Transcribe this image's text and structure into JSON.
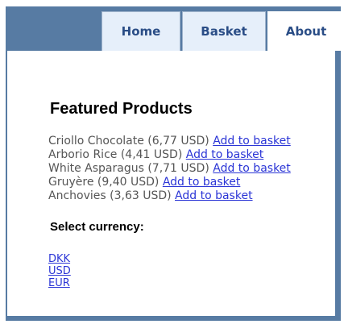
{
  "nav": {
    "tabs": [
      {
        "label": "Home"
      },
      {
        "label": "Basket"
      },
      {
        "label": "About"
      }
    ]
  },
  "main": {
    "title": "Featured Products",
    "products": [
      {
        "text": "Criollo Chocolate (6,77 USD) ",
        "link": "Add to basket"
      },
      {
        "text": "Arborio Rice (4,41 USD) ",
        "link": "Add to basket"
      },
      {
        "text": "White Asparagus (7,71 USD) ",
        "link": "Add to basket"
      },
      {
        "text": "Gruyère (9,40 USD) ",
        "link": "Add to basket"
      },
      {
        "text": "Anchovies (3,63 USD) ",
        "link": "Add to basket"
      }
    ],
    "currency_heading": "Select currency:",
    "currencies": [
      "DKK",
      "USD",
      "EUR"
    ]
  },
  "colors": {
    "frame": "#577ba3",
    "tab_background": "#e6effa",
    "tab_text": "#2a4d86",
    "link": "#2b35d6",
    "body_text": "#555555"
  }
}
